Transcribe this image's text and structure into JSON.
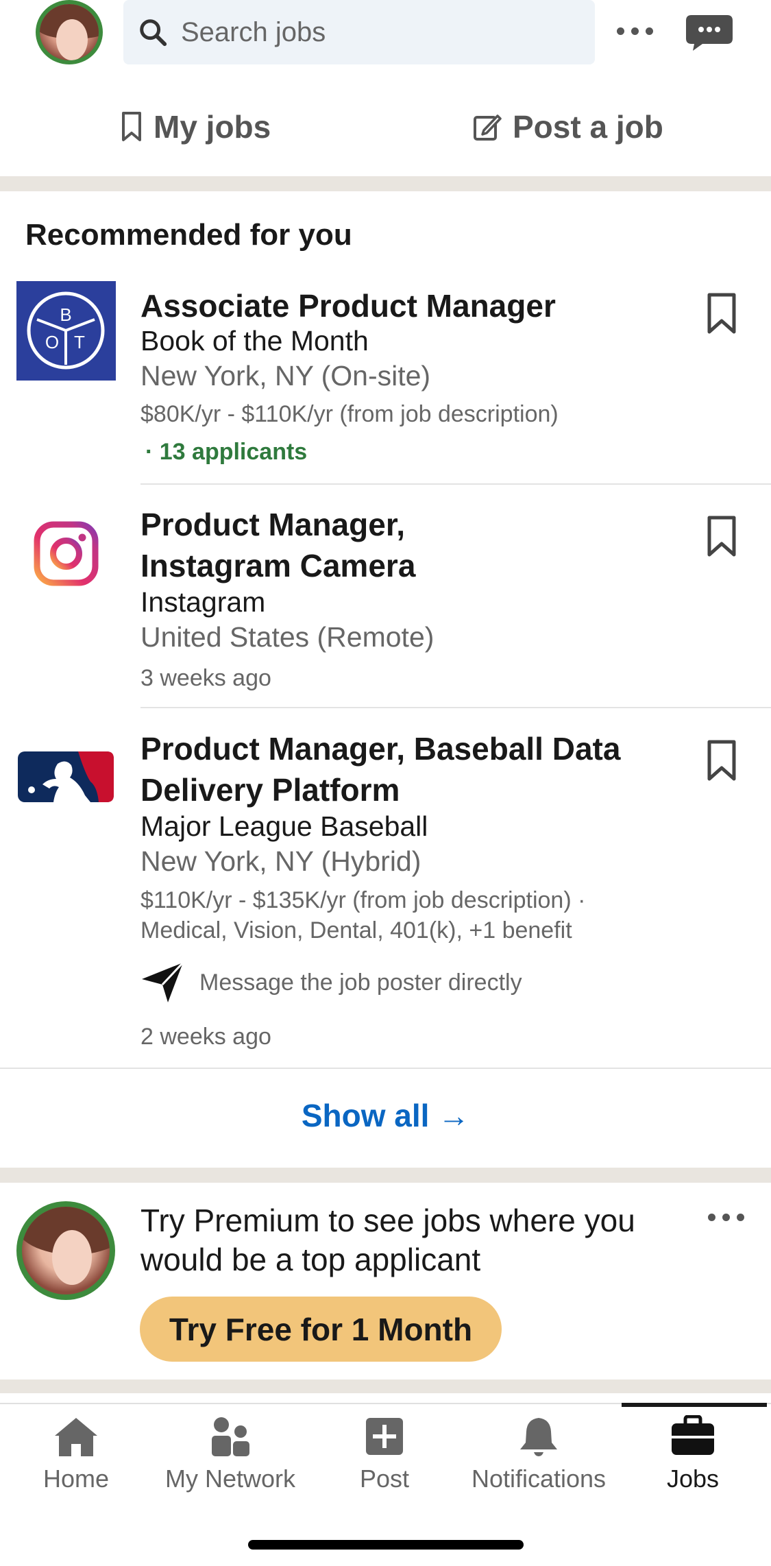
{
  "header": {
    "search_placeholder": "Search jobs"
  },
  "tabs": {
    "my_jobs": "My jobs",
    "post_job": "Post a job"
  },
  "section_title": "Recommended for you",
  "jobs": [
    {
      "title": "Associate Product Manager",
      "company": "Book of the Month",
      "location": "New York, NY (On-site)",
      "salary": "$80K/yr - $110K/yr (from job description)",
      "applicants": "· 13 applicants",
      "logo_letters": [
        "B",
        "O",
        "T"
      ]
    },
    {
      "title_line1": "Product Manager,",
      "title_line2": "Instagram Camera",
      "company": "Instagram",
      "location": "United States (Remote)",
      "posted": "3 weeks ago"
    },
    {
      "title_line1": "Product Manager, Baseball Data",
      "title_line2": "Delivery Platform",
      "company": "Major League Baseball",
      "location": "New York, NY (Hybrid)",
      "salary": "$110K/yr - $135K/yr (from job description) ·",
      "benefits": "Medical, Vision, Dental, 401(k), +1 benefit",
      "message": "Message the job poster directly",
      "posted": "2 weeks ago"
    }
  ],
  "show_all": "Show all →",
  "premium": {
    "text": "Try Premium to see jobs where you would be a top applicant",
    "button": "Try Free for 1 Month"
  },
  "nav": {
    "items": [
      {
        "label": "Home",
        "icon": "home-icon"
      },
      {
        "label": "My Network",
        "icon": "network-icon"
      },
      {
        "label": "Post",
        "icon": "post-icon"
      },
      {
        "label": "Notifications",
        "icon": "bell-icon"
      },
      {
        "label": "Jobs",
        "icon": "briefcase-icon",
        "active": true
      }
    ]
  },
  "colors": {
    "accent_blue": "#0a66c2",
    "green": "#2f7a3d",
    "premium_gold": "#f2c57a"
  }
}
